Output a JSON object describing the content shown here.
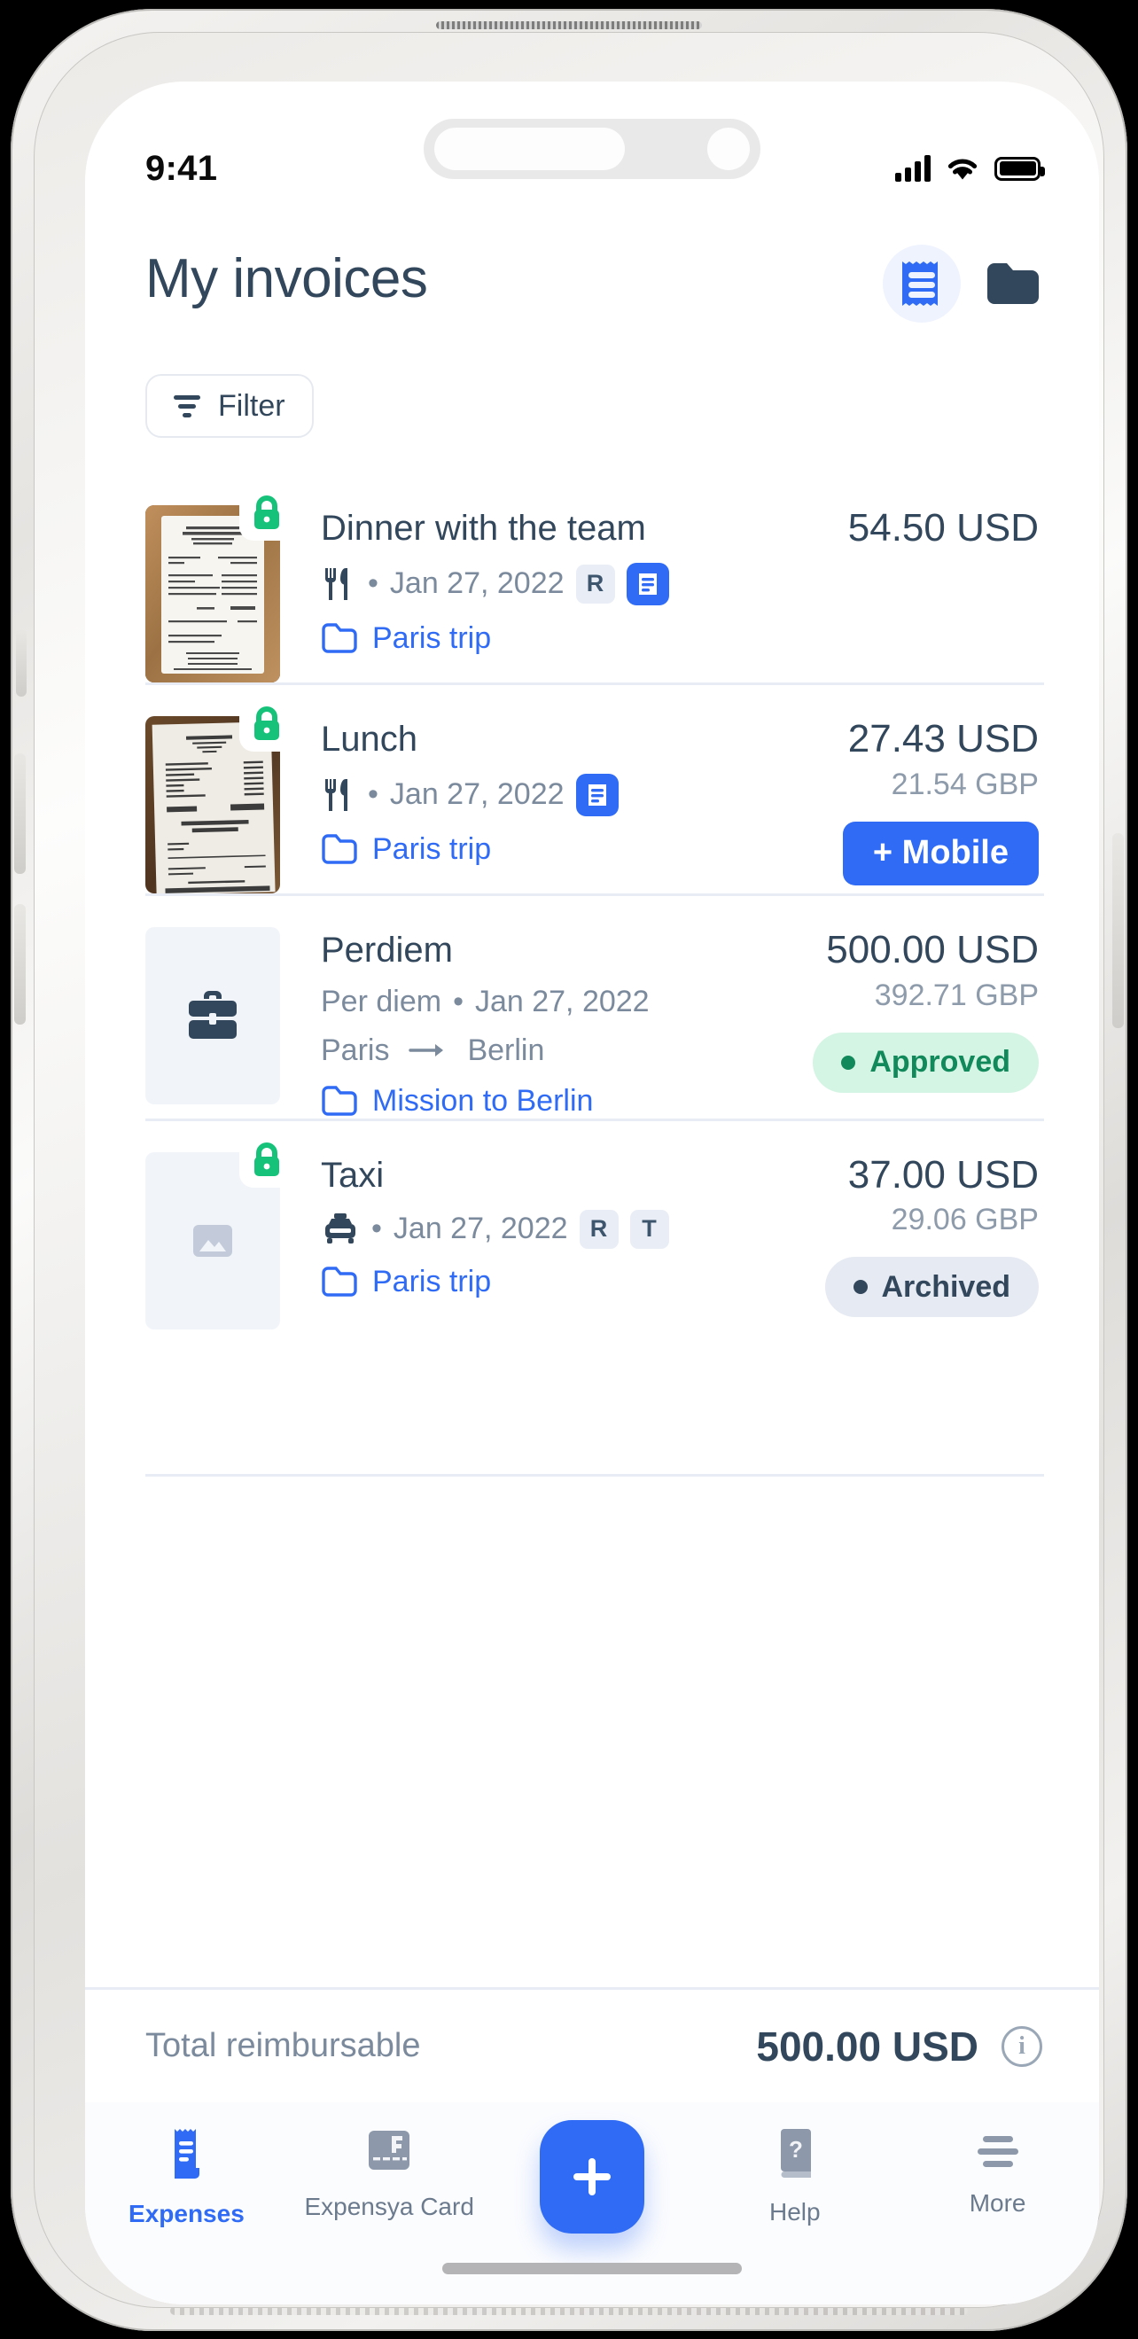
{
  "status_bar": {
    "time": "9:41",
    "signal_icon": "cellular-bars-icon",
    "wifi_icon": "wifi-icon",
    "battery_icon": "battery-full-icon"
  },
  "header": {
    "title": "My invoices",
    "actions": [
      {
        "name": "receipts-button",
        "icon": "receipt-icon"
      },
      {
        "name": "folders-button",
        "icon": "folder-icon"
      }
    ]
  },
  "filter": {
    "label": "Filter",
    "icon": "filter-funnel-icon"
  },
  "expenses": [
    {
      "title": "Dinner with the team",
      "category_icon": "restaurant-icon",
      "date": "Jan 27, 2022",
      "badges": [
        "R"
      ],
      "has_receipt_badge": true,
      "trip": "Paris trip",
      "amount": "54.50 USD",
      "amount_secondary": "",
      "thumbnail": "receipt-photo",
      "thumbnail_locked": true,
      "action_label": "",
      "status": ""
    },
    {
      "title": "Lunch",
      "category_icon": "restaurant-icon",
      "date": "Jan 27, 2022",
      "badges": [],
      "has_receipt_badge": true,
      "trip": "Paris trip",
      "amount": "27.43 USD",
      "amount_secondary": "21.54 GBP",
      "thumbnail": "receipt-photo",
      "thumbnail_locked": true,
      "action_label": "+ Mobile",
      "status": ""
    },
    {
      "title": "Perdiem",
      "category_icon": "briefcase-icon",
      "category_text": "Per diem",
      "date": "Jan 27, 2022",
      "badges": [],
      "has_receipt_badge": false,
      "route_from": "Paris",
      "route_to": "Berlin",
      "trip": "Mission to Berlin",
      "amount": "500.00 USD",
      "amount_secondary": "392.71 GBP",
      "thumbnail": "briefcase-placeholder",
      "thumbnail_locked": false,
      "action_label": "",
      "status": "Approved",
      "status_type": "approved"
    },
    {
      "title": "Taxi",
      "category_icon": "taxi-icon",
      "date": "Jan 27, 2022",
      "badges": [
        "R",
        "T"
      ],
      "has_receipt_badge": false,
      "trip": "Paris trip",
      "amount": "37.00 USD",
      "amount_secondary": "29.06 GBP",
      "thumbnail": "image-placeholder",
      "thumbnail_locked": true,
      "action_label": "",
      "status": "Archived",
      "status_type": "archived"
    }
  ],
  "total": {
    "label": "Total reimbursable",
    "amount": "500.00 USD",
    "info_icon": "info-icon",
    "info_glyph": "i"
  },
  "tabbar": [
    {
      "label": "Expenses",
      "icon": "receipt-icon",
      "active": true
    },
    {
      "label": "Expensya Card",
      "icon": "card-icon",
      "active": false
    },
    {
      "label": "",
      "icon": "plus-icon",
      "active": false,
      "fab": true
    },
    {
      "label": "Help",
      "icon": "help-book-icon",
      "active": false
    },
    {
      "label": "More",
      "icon": "menu-lines-icon",
      "active": false
    }
  ],
  "colors": {
    "accent_blue": "#2f6bf5",
    "title_slate": "#32475b",
    "muted": "#7b8a9c",
    "green": "#12895a",
    "green_bg": "#d4f5e3",
    "lock_green": "#16c27a",
    "divider": "#e8ecf4"
  }
}
